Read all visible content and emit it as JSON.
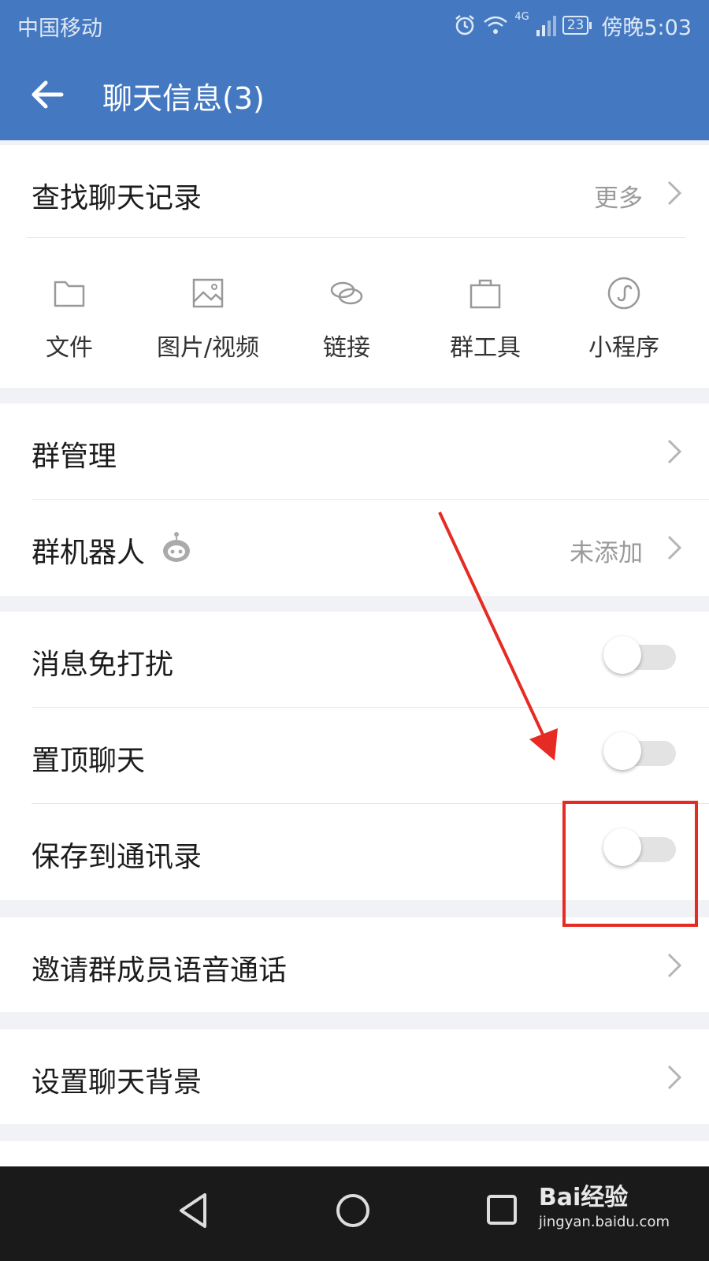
{
  "status_bar": {
    "carrier": "中国移动",
    "network": "4G",
    "battery": "23",
    "time": "傍晚5:03"
  },
  "header": {
    "title": "聊天信息(3)"
  },
  "search_history": {
    "label": "查找聊天记录",
    "more": "更多"
  },
  "media_tools": [
    {
      "label": "文件",
      "icon": "folder-icon"
    },
    {
      "label": "图片/视频",
      "icon": "image-icon"
    },
    {
      "label": "链接",
      "icon": "link-icon"
    },
    {
      "label": "群工具",
      "icon": "briefcase-icon"
    },
    {
      "label": "小程序",
      "icon": "mini-program-icon"
    }
  ],
  "group_section": {
    "manage_label": "群管理",
    "robot_label": "群机器人",
    "robot_value": "未添加"
  },
  "toggles": {
    "mute_label": "消息免打扰",
    "mute_on": false,
    "pin_label": "置顶聊天",
    "pin_on": false,
    "save_contacts_label": "保存到通讯录",
    "save_contacts_on": false
  },
  "voice_call": {
    "label": "邀请群成员语音通话"
  },
  "background": {
    "label": "设置聊天背景"
  },
  "watermark": {
    "brand": "Bai经验",
    "url": "jingyan.baidu.com"
  },
  "colors": {
    "header": "#4479c2",
    "annotation": "#e52b24",
    "navbar": "#1a1a1a"
  }
}
